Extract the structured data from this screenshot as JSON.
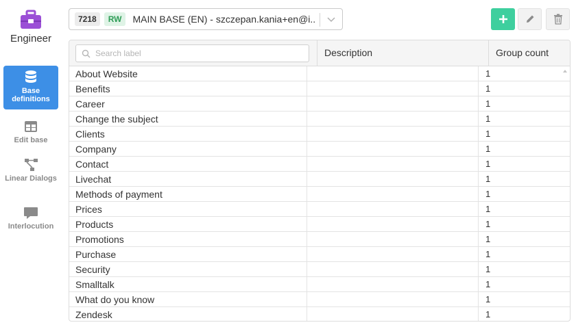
{
  "sidebar": {
    "brand_label": "Engineer",
    "brand_icon": "toolbox-icon",
    "items": [
      {
        "label": "Base definitions",
        "icon": "database-icon",
        "active": true
      },
      {
        "label": "Edit base",
        "icon": "table-icon",
        "active": false
      },
      {
        "label": "Linear Dialogs",
        "icon": "flow-icon",
        "active": false
      },
      {
        "label": "Interlocution",
        "icon": "chat-icon",
        "active": false
      }
    ]
  },
  "base_select": {
    "id": "7218",
    "mode": "RW",
    "name": "MAIN BASE (EN) - szczepan.kania+en@i..."
  },
  "toolbar": {
    "add_icon": "plus-icon",
    "edit_icon": "pencil-icon",
    "delete_icon": "trash-icon"
  },
  "table": {
    "search_placeholder": "Search label",
    "columns": {
      "description": "Description",
      "group_count": "Group count"
    },
    "rows": [
      {
        "label": "About Website",
        "description": "",
        "count": "1"
      },
      {
        "label": "Benefits",
        "description": "",
        "count": "1"
      },
      {
        "label": "Career",
        "description": "",
        "count": "1"
      },
      {
        "label": "Change the subject",
        "description": "",
        "count": "1"
      },
      {
        "label": "Clients",
        "description": "",
        "count": "1"
      },
      {
        "label": "Company",
        "description": "",
        "count": "1"
      },
      {
        "label": "Contact",
        "description": "",
        "count": "1"
      },
      {
        "label": "Livechat",
        "description": "",
        "count": "1"
      },
      {
        "label": "Methods of payment",
        "description": "",
        "count": "1"
      },
      {
        "label": "Prices",
        "description": "",
        "count": "1"
      },
      {
        "label": "Products",
        "description": "",
        "count": "1"
      },
      {
        "label": "Promotions",
        "description": "",
        "count": "1"
      },
      {
        "label": "Purchase",
        "description": "",
        "count": "1"
      },
      {
        "label": "Security",
        "description": "",
        "count": "1"
      },
      {
        "label": "Smalltalk",
        "description": "",
        "count": "1"
      },
      {
        "label": "What do you know",
        "description": "",
        "count": "1"
      },
      {
        "label": "Zendesk",
        "description": "",
        "count": "1"
      }
    ]
  },
  "colors": {
    "accent": "#3d8fe6",
    "add_button": "#3ecf9e",
    "brand": "#9b4fd6",
    "rw_badge": "#2f9d57"
  }
}
